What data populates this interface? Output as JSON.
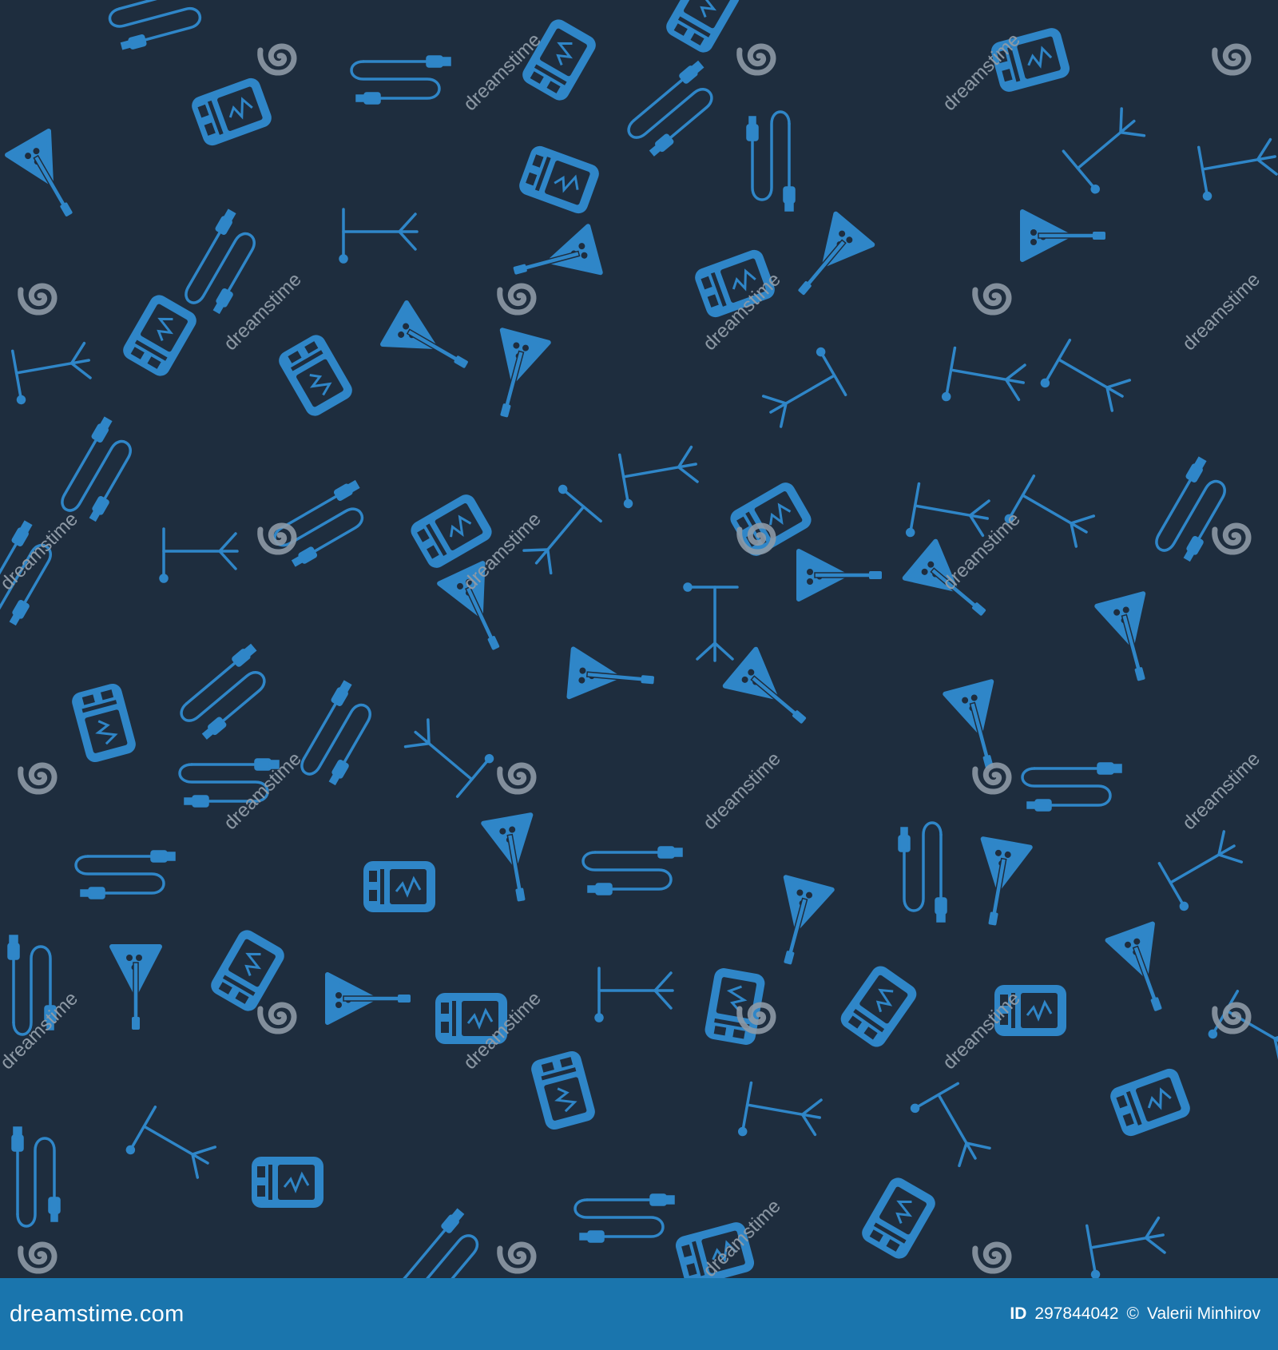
{
  "watermark": {
    "text": "dreamstime",
    "color": "#8e9aa6"
  },
  "pattern": {
    "background": "#1e2d3e",
    "icon_color": "#2f86c8",
    "icon_color_alt": "#3a93d3",
    "icons": [
      "electric-guitar-icon",
      "guitar-tuner-icon",
      "audio-cable-icon",
      "microphone-stand-icon"
    ]
  },
  "footer": {
    "background": "#1a75ad",
    "domain": "dreamstime.com",
    "id_label": "ID",
    "id_value": "297844042",
    "copyright_symbol": "©",
    "author": "Valerii Minhirov"
  }
}
